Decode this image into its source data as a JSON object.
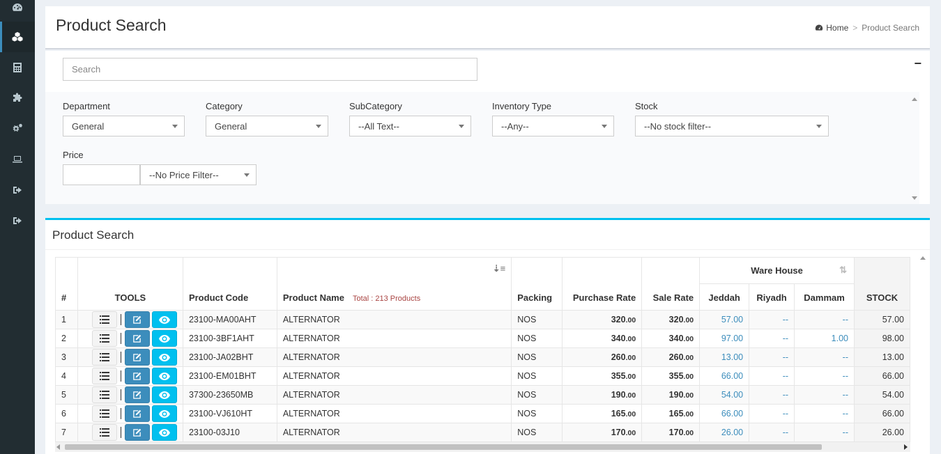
{
  "sidebar": {
    "items": [
      {
        "icon": "dashboard-icon"
      },
      {
        "icon": "cubes-icon",
        "active": true
      },
      {
        "icon": "calculator-icon"
      },
      {
        "icon": "puzzle-icon"
      },
      {
        "icon": "cogs-icon"
      },
      {
        "icon": "laptop-icon"
      },
      {
        "icon": "sign-out-icon"
      },
      {
        "icon": "sign-out-icon"
      }
    ]
  },
  "header": {
    "title": "Product Search",
    "breadcrumb_home": "Home",
    "breadcrumb_sep": ">",
    "breadcrumb_current": "Product Search"
  },
  "filters": {
    "search_placeholder": "Search",
    "collapse_label": "−",
    "department_label": "Department",
    "department_value": "General",
    "category_label": "Category",
    "category_value": "General",
    "subcategory_label": "SubCategory",
    "subcategory_value": "--All Text--",
    "inventory_type_label": "Inventory Type",
    "inventory_type_value": "--Any--",
    "stock_label": "Stock",
    "stock_value": "--No stock filter--",
    "price_label": "Price",
    "price_filter_value": "--No Price Filter--"
  },
  "results": {
    "title": "Product Search",
    "columns": {
      "index": "#",
      "tools": "TOOLS",
      "product_code": "Product Code",
      "product_name": "Product Name",
      "total": "Total : 213 Products",
      "packing": "Packing",
      "purchase_rate": "Purchase Rate",
      "sale_rate": "Sale Rate",
      "warehouse": "Ware House",
      "jeddah": "Jeddah",
      "riyadh": "Riyadh",
      "dammam": "Dammam",
      "stock": "STOCK"
    },
    "rows": [
      {
        "n": "1",
        "code": "23100-MA00AHT",
        "name": "ALTERNATOR",
        "packing": "NOS",
        "purchase_int": "320",
        "purchase_dec": ".00",
        "sale_int": "320",
        "sale_dec": ".00",
        "jeddah": "57.00",
        "riyadh": "--",
        "dammam": "--",
        "stock": "57.00"
      },
      {
        "n": "2",
        "code": "23100-3BF1AHT",
        "name": "ALTERNATOR",
        "packing": "NOS",
        "purchase_int": "340",
        "purchase_dec": ".00",
        "sale_int": "340",
        "sale_dec": ".00",
        "jeddah": "97.00",
        "riyadh": "--",
        "dammam": "1.00",
        "stock": "98.00"
      },
      {
        "n": "3",
        "code": "23100-JA02BHT",
        "name": "ALTERNATOR",
        "packing": "NOS",
        "purchase_int": "260",
        "purchase_dec": ".00",
        "sale_int": "260",
        "sale_dec": ".00",
        "jeddah": "13.00",
        "riyadh": "--",
        "dammam": "--",
        "stock": "13.00"
      },
      {
        "n": "4",
        "code": "23100-EM01BHT",
        "name": "ALTERNATOR",
        "packing": "NOS",
        "purchase_int": "355",
        "purchase_dec": ".00",
        "sale_int": "355",
        "sale_dec": ".00",
        "jeddah": "66.00",
        "riyadh": "--",
        "dammam": "--",
        "stock": "66.00"
      },
      {
        "n": "5",
        "code": "37300-23650MB",
        "name": "ALTERNATOR",
        "packing": "NOS",
        "purchase_int": "190",
        "purchase_dec": ".00",
        "sale_int": "190",
        "sale_dec": ".00",
        "jeddah": "54.00",
        "riyadh": "--",
        "dammam": "--",
        "stock": "54.00"
      },
      {
        "n": "6",
        "code": "23100-VJ610HT",
        "name": "ALTERNATOR",
        "packing": "NOS",
        "purchase_int": "165",
        "purchase_dec": ".00",
        "sale_int": "165",
        "sale_dec": ".00",
        "jeddah": "66.00",
        "riyadh": "--",
        "dammam": "--",
        "stock": "66.00"
      },
      {
        "n": "7",
        "code": "23100-03J10",
        "name": "ALTERNATOR",
        "packing": "NOS",
        "purchase_int": "170",
        "purchase_dec": ".00",
        "sale_int": "170",
        "sale_dec": ".00",
        "jeddah": "26.00",
        "riyadh": "--",
        "dammam": "--",
        "stock": "26.00"
      }
    ]
  }
}
